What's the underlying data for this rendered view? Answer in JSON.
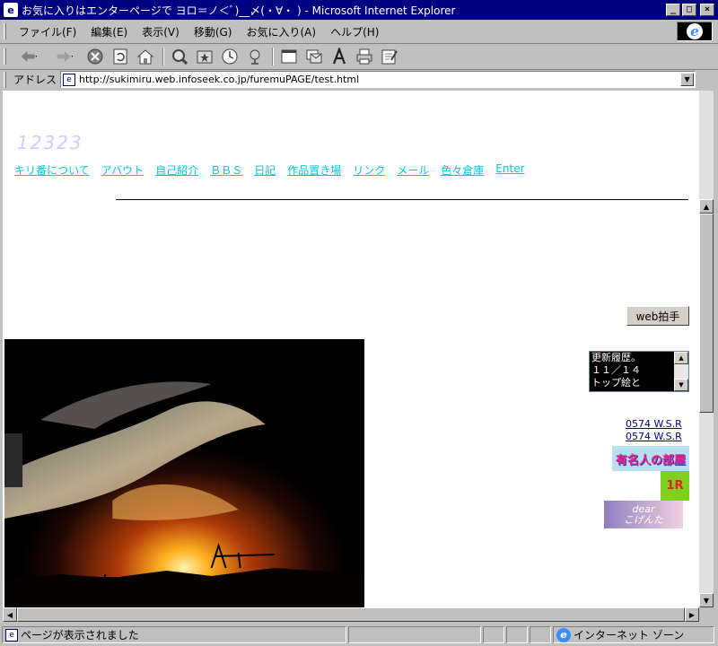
{
  "window": {
    "title": "お気に入りはエンターページで ヨロ＝ノ＜ﾞ)__〆(・∀・ ) - Microsoft Internet Explorer",
    "minimize": "_",
    "maximize": "□",
    "close": "×"
  },
  "menu": {
    "items": [
      "ファイル(F)",
      "編集(E)",
      "表示(V)",
      "移動(G)",
      "お気に入り(A)",
      "ヘルプ(H)"
    ]
  },
  "toolbar": {
    "icons": [
      "back-icon",
      "forward-icon",
      "stop-icon",
      "refresh-icon",
      "home-icon",
      "search-icon",
      "favorites-icon",
      "history-icon",
      "channels-icon",
      "fullscreen-icon",
      "mail-icon",
      "font-icon",
      "print-icon",
      "edit-icon"
    ]
  },
  "address": {
    "label": "アドレス",
    "url": "http://sukimiru.web.infoseek.co.jp/furemuPAGE/test.html"
  },
  "page": {
    "site_title": "12323",
    "nav": [
      "キリ番について",
      "アバウト",
      "自己紹介",
      "ＢＢＳ",
      "日記",
      "作品置き場",
      "リンク",
      "メール",
      "色々倉庫",
      "Enter"
    ],
    "clap_button": "web拍手",
    "history_lines": [
      "更新履歴。",
      "１１／１４",
      "トップ絵と"
    ],
    "counter_links": [
      "0574 W.S.R",
      "0574 W.S.R"
    ],
    "banners": {
      "famous": "有名人の部屋",
      "one_r": "1R",
      "dear": "dear",
      "dear_sub": "こげんた"
    }
  },
  "status": {
    "text": "ページが表示されました",
    "zone": "インターネット ゾーン"
  },
  "colors": {
    "titlebar": "#000080",
    "nav_link": "#00c8e6",
    "site_title": "#c8d0ff",
    "history_bg": "#000000"
  }
}
